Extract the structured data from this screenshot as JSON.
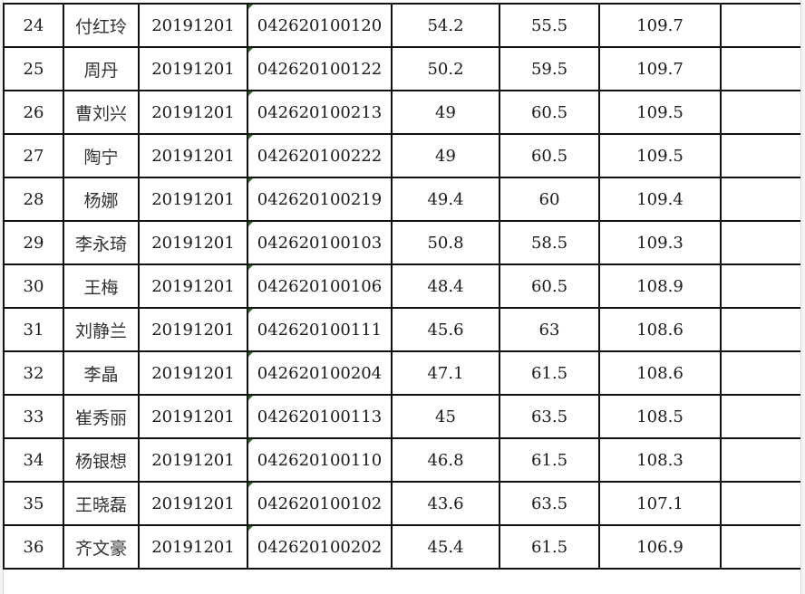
{
  "table": {
    "columns": [
      "seq",
      "name",
      "position_code",
      "exam_number",
      "score_1",
      "score_2",
      "total",
      "remark"
    ],
    "rows": [
      {
        "seq": "24",
        "name": "付红玲",
        "position_code": "20191201",
        "exam_number": "042620100120",
        "score_1": "54.2",
        "score_2": "55.5",
        "total": "109.7",
        "remark": ""
      },
      {
        "seq": "25",
        "name": "周丹",
        "position_code": "20191201",
        "exam_number": "042620100122",
        "score_1": "50.2",
        "score_2": "59.5",
        "total": "109.7",
        "remark": ""
      },
      {
        "seq": "26",
        "name": "曹刘兴",
        "position_code": "20191201",
        "exam_number": "042620100213",
        "score_1": "49",
        "score_2": "60.5",
        "total": "109.5",
        "remark": ""
      },
      {
        "seq": "27",
        "name": "陶宁",
        "position_code": "20191201",
        "exam_number": "042620100222",
        "score_1": "49",
        "score_2": "60.5",
        "total": "109.5",
        "remark": ""
      },
      {
        "seq": "28",
        "name": "杨娜",
        "position_code": "20191201",
        "exam_number": "042620100219",
        "score_1": "49.4",
        "score_2": "60",
        "total": "109.4",
        "remark": ""
      },
      {
        "seq": "29",
        "name": "李永琦",
        "position_code": "20191201",
        "exam_number": "042620100103",
        "score_1": "50.8",
        "score_2": "58.5",
        "total": "109.3",
        "remark": ""
      },
      {
        "seq": "30",
        "name": "王梅",
        "position_code": "20191201",
        "exam_number": "042620100106",
        "score_1": "48.4",
        "score_2": "60.5",
        "total": "108.9",
        "remark": ""
      },
      {
        "seq": "31",
        "name": "刘静兰",
        "position_code": "20191201",
        "exam_number": "042620100111",
        "score_1": "45.6",
        "score_2": "63",
        "total": "108.6",
        "remark": ""
      },
      {
        "seq": "32",
        "name": "李晶",
        "position_code": "20191201",
        "exam_number": "042620100204",
        "score_1": "47.1",
        "score_2": "61.5",
        "total": "108.6",
        "remark": ""
      },
      {
        "seq": "33",
        "name": "崔秀丽",
        "position_code": "20191201",
        "exam_number": "042620100113",
        "score_1": "45",
        "score_2": "63.5",
        "total": "108.5",
        "remark": ""
      },
      {
        "seq": "34",
        "name": "杨银想",
        "position_code": "20191201",
        "exam_number": "042620100110",
        "score_1": "46.8",
        "score_2": "61.5",
        "total": "108.3",
        "remark": ""
      },
      {
        "seq": "35",
        "name": "王晓磊",
        "position_code": "20191201",
        "exam_number": "042620100102",
        "score_1": "43.6",
        "score_2": "63.5",
        "total": "107.1",
        "remark": ""
      },
      {
        "seq": "36",
        "name": "齐文豪",
        "position_code": "20191201",
        "exam_number": "042620100202",
        "score_1": "45.4",
        "score_2": "61.5",
        "total": "106.9",
        "remark": ""
      }
    ]
  },
  "colors": {
    "grid_border": "#111111",
    "text": "#1a1a1a",
    "text_indicator": "#1f7a1f"
  }
}
